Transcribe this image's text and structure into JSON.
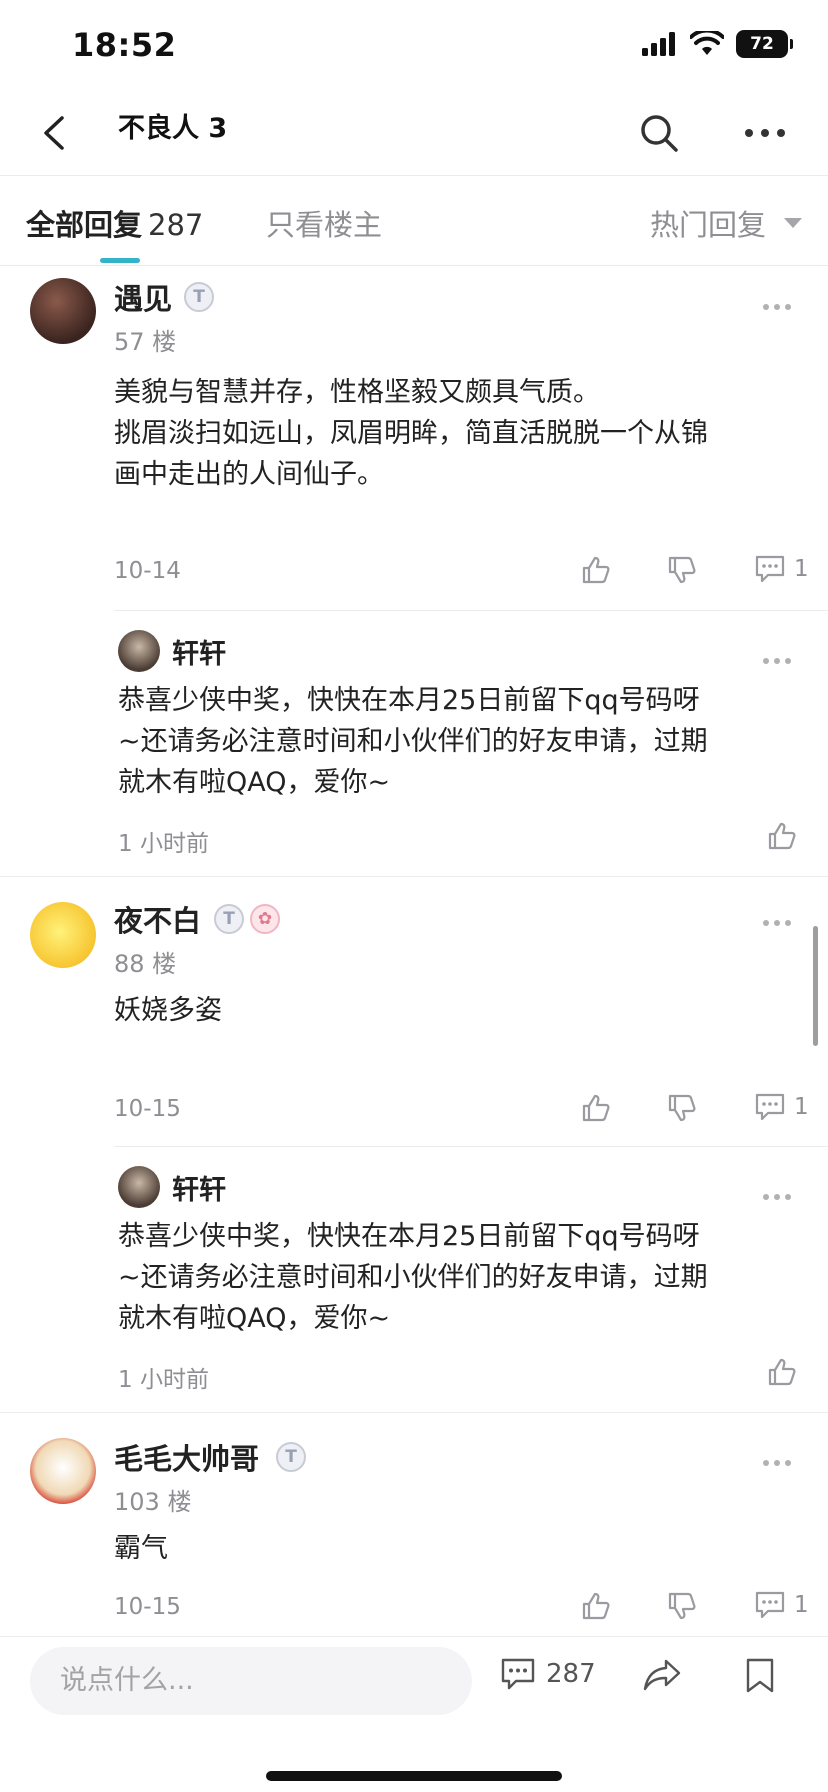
{
  "status": {
    "time": "18:52",
    "battery": "72"
  },
  "nav": {
    "title": "不良人 3"
  },
  "tabs": {
    "all_label": "全部回复",
    "all_count": "287",
    "owner_label": "只看楼主",
    "sort_label": "热门回复"
  },
  "comments": [
    {
      "name": "遇见",
      "badge": "T",
      "floor": "57 楼",
      "lines": [
        "美貌与智慧并存，性格坚毅又颇具气质。",
        "挑眉淡扫如远山，凤眉明眸，简直活脱脱一个从锦",
        "画中走出的人间仙子。"
      ],
      "date": "10-14",
      "reply_count": "1",
      "reply": {
        "name": "轩轩",
        "lines": [
          "恭喜少侠中奖，快快在本月25日前留下qq号码呀",
          "~还请务必注意时间和小伙伴们的好友申请，过期",
          "就木有啦QAQ，爱你~"
        ],
        "time": "1 小时前"
      }
    },
    {
      "name": "夜不白",
      "badge": "T",
      "floor": "88 楼",
      "lines": [
        "妖娆多姿"
      ],
      "date": "10-15",
      "reply_count": "1",
      "reply": {
        "name": "轩轩",
        "lines": [
          "恭喜少侠中奖，快快在本月25日前留下qq号码呀",
          "~还请务必注意时间和小伙伴们的好友申请，过期",
          "就木有啦QAQ，爱你~"
        ],
        "time": "1 小时前"
      }
    },
    {
      "name": "毛毛大帅哥",
      "badge": "T",
      "floor": "103 楼",
      "lines": [
        "霸气"
      ],
      "date": "10-15",
      "reply_count": "1"
    }
  ],
  "bottom": {
    "placeholder": "说点什么...",
    "comment_count": "287"
  }
}
